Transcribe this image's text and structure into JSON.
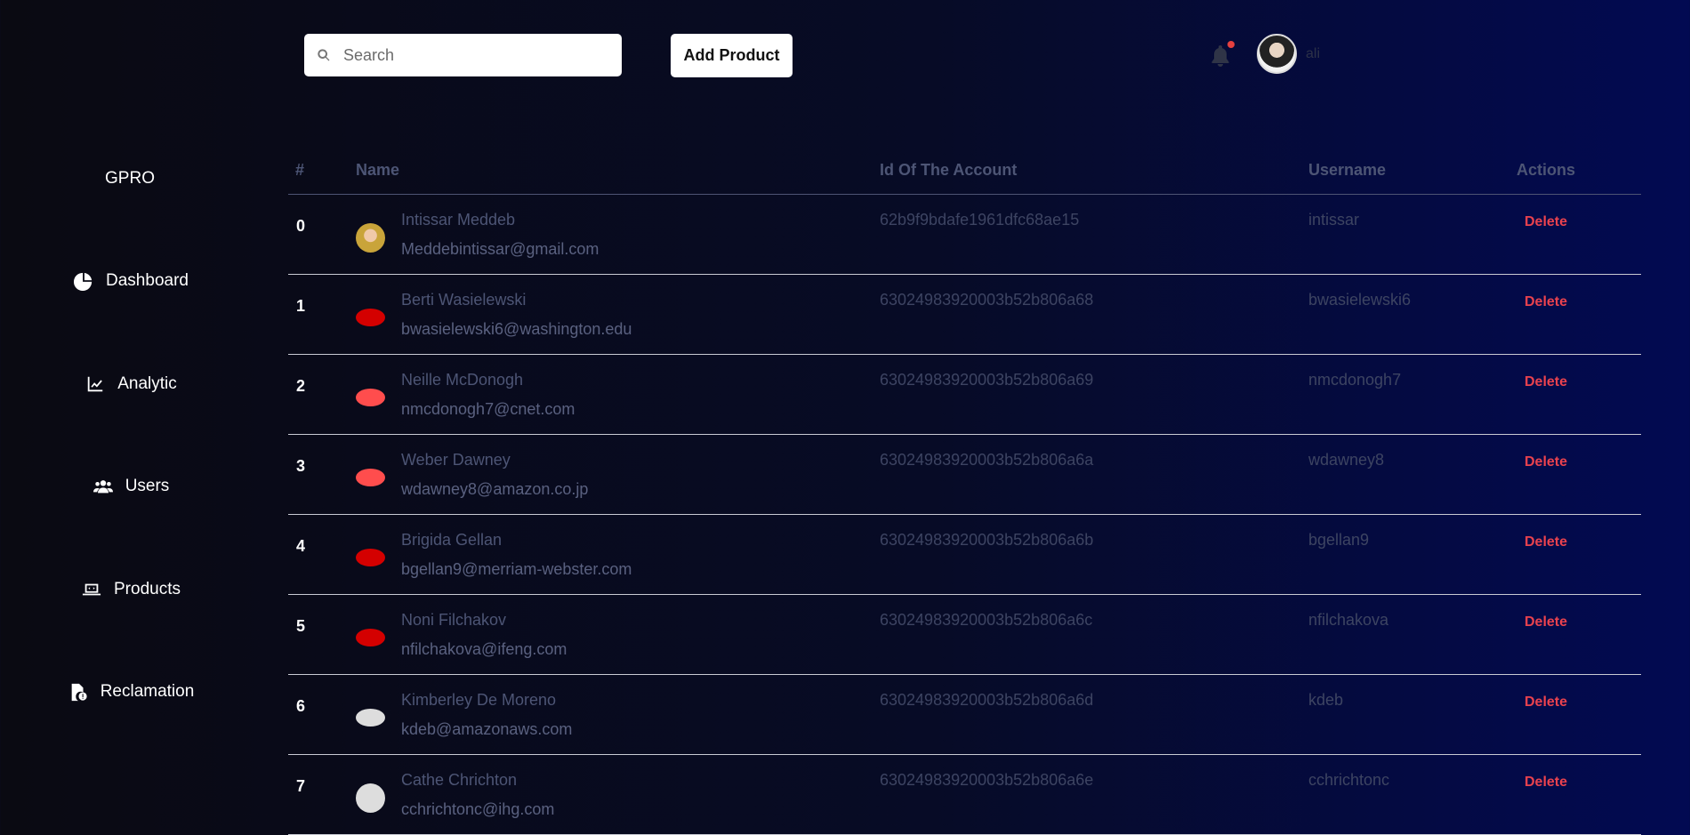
{
  "sidebar": {
    "brand": "GPRO",
    "items": [
      {
        "label": "Dashboard",
        "icon": "pie-chart-icon"
      },
      {
        "label": "Analytic",
        "icon": "line-chart-icon"
      },
      {
        "label": "Users",
        "icon": "users-icon"
      },
      {
        "label": "Products",
        "icon": "laptop-icon"
      },
      {
        "label": "Reclamation",
        "icon": "file-alert-icon"
      }
    ]
  },
  "topbar": {
    "search_placeholder": "Search",
    "add_product_label": "Add Product",
    "user_name": "ali"
  },
  "table": {
    "headers": {
      "index": "#",
      "name": "Name",
      "account_id": "Id Of The Account",
      "username": "Username",
      "actions": "Actions"
    },
    "delete_label": "Delete",
    "rows": [
      {
        "index": "0",
        "name": "Intissar Meddeb",
        "email": "Meddebintissar@gmail.com",
        "account_id": "62b9f9bdafe1961dfc68ae15",
        "username": "intissar",
        "avatar_color": "#c9a43a"
      },
      {
        "index": "1",
        "name": "Berti Wasielewski",
        "email": "bwasielewski6@washington.edu",
        "account_id": "63024983920003b52b806a68",
        "username": "bwasielewski6",
        "avatar_color": "#d40000"
      },
      {
        "index": "2",
        "name": "Neille McDonogh",
        "email": "nmcdonogh7@cnet.com",
        "account_id": "63024983920003b52b806a69",
        "username": "nmcdonogh7",
        "avatar_color": "#ff4d4d"
      },
      {
        "index": "3",
        "name": "Weber Dawney",
        "email": "wdawney8@amazon.co.jp",
        "account_id": "63024983920003b52b806a6a",
        "username": "wdawney8",
        "avatar_color": "#ff4d4d"
      },
      {
        "index": "4",
        "name": "Brigida Gellan",
        "email": "bgellan9@merriam-webster.com",
        "account_id": "63024983920003b52b806a6b",
        "username": "bgellan9",
        "avatar_color": "#d40000"
      },
      {
        "index": "5",
        "name": "Noni Filchakov",
        "email": "nfilchakova@ifeng.com",
        "account_id": "63024983920003b52b806a6c",
        "username": "nfilchakova",
        "avatar_color": "#d40000"
      },
      {
        "index": "6",
        "name": "Kimberley De Moreno",
        "email": "kdeb@amazonaws.com",
        "account_id": "63024983920003b52b806a6d",
        "username": "kdeb",
        "avatar_color": "#dddddd"
      },
      {
        "index": "7",
        "name": "Cathe Chrichton",
        "email": "cchrichtonc@ihg.com",
        "account_id": "63024983920003b52b806a6e",
        "username": "cchrichtonc",
        "avatar_color": "#dddddd"
      }
    ]
  }
}
